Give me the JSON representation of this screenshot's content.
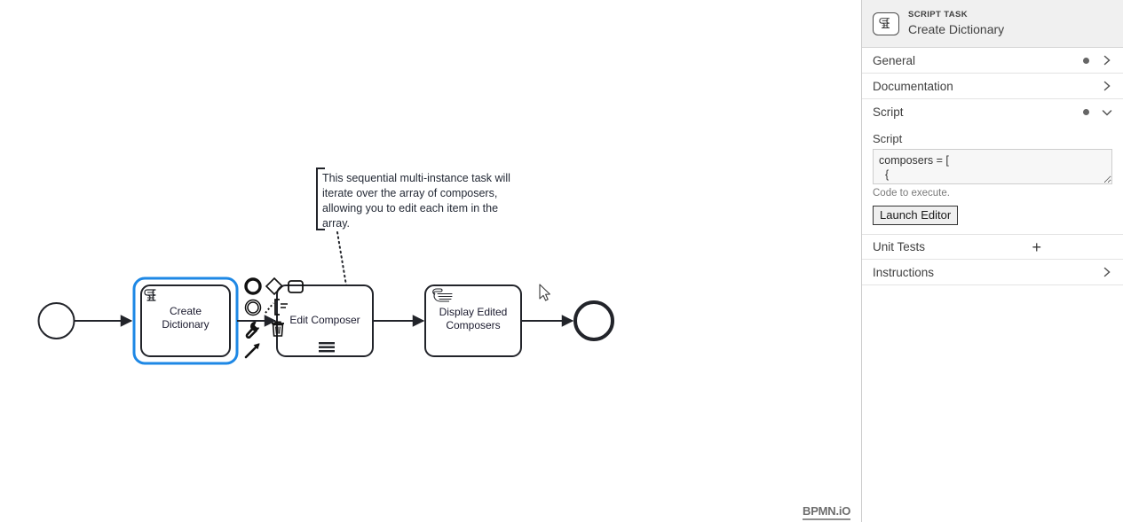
{
  "canvas": {
    "elements": {
      "start_event": {
        "name": "start-event",
        "type": "startEvent"
      },
      "script_task": {
        "label": "Create\nDictionary",
        "line1": "Create",
        "line2": "Dictionary",
        "type": "scriptTask",
        "selected": true
      },
      "multi_task": {
        "line1": "Edit Composer",
        "type": "userTask",
        "marker": "sequential-multi-instance"
      },
      "manual_task": {
        "line1": "Display Edited",
        "line2": "Composers",
        "type": "manualTask"
      },
      "end_event": {
        "name": "end-event",
        "type": "endEvent"
      }
    },
    "annotation": {
      "lines": [
        "This sequential multi-instance task will",
        "iterate over the array of composers,",
        "allowing you to edit each item in the",
        "array."
      ]
    },
    "context_pad": {
      "entries": [
        {
          "name": "append-end-event",
          "icon": "circle-thick-icon"
        },
        {
          "name": "append-gateway",
          "icon": "diamond-icon"
        },
        {
          "name": "append-task",
          "icon": "rounded-rect-icon"
        },
        {
          "name": "append-intermediate-event",
          "icon": "double-circle-icon"
        },
        {
          "name": "append-text-annotation",
          "icon": "text-annotation-icon"
        },
        {
          "name": "replace-element",
          "icon": "wrench-icon"
        },
        {
          "name": "delete-element",
          "icon": "trash-icon"
        },
        {
          "name": "connect-element",
          "icon": "arrow-icon"
        }
      ]
    },
    "watermark": "BPMN.iO"
  },
  "properties_panel": {
    "header": {
      "type_label": "SCRIPT TASK",
      "name": "Create Dictionary",
      "icon": "script-task-icon"
    },
    "groups": [
      {
        "title": "General",
        "has_dot": true,
        "expanded": false,
        "chevron": "chevron-right-icon"
      },
      {
        "title": "Documentation",
        "has_dot": false,
        "expanded": false,
        "chevron": "chevron-right-icon"
      },
      {
        "title": "Script",
        "has_dot": true,
        "expanded": true,
        "chevron": "chevron-down-icon"
      }
    ],
    "script_group": {
      "field_label": "Script",
      "textarea_value": "composers = [\n  {",
      "textarea_placeholder": "",
      "hint": "Code to execute.",
      "launch_button": "Launch Editor"
    },
    "unit_tests": {
      "title": "Unit Tests",
      "add_icon": "plus-icon"
    },
    "instructions": {
      "title": "Instructions",
      "chevron": "chevron-right-icon"
    }
  },
  "colors": {
    "selection": "#1E88E5",
    "stroke": "#22242a",
    "panel_header_bg": "#f0f0f0",
    "panel_border": "#cdcdcd"
  }
}
